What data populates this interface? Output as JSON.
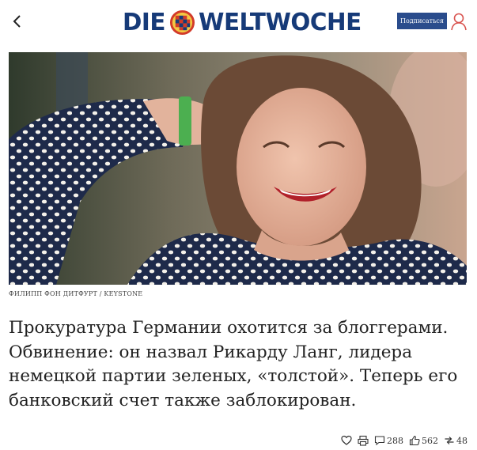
{
  "header": {
    "logo_left": "DIE",
    "logo_right": "WELTWOCHE",
    "subscribe_label": "Подписаться"
  },
  "photo": {
    "caption": "ФИЛИПП ФОН ДИТФУРТ / KEYSTONE"
  },
  "article": {
    "headline": "Прокуратура Германии охотится за блоггерами. Обвинение: он назвал Рикарду Ланг, лидера немецкой партии зеленых, «толстой». Теперь его банковский счет также заблокирован."
  },
  "actions": {
    "comments": "288",
    "likes": "562",
    "reposts": "48"
  },
  "colors": {
    "brand": "#163a78",
    "subscribe_bg": "#2a4c8c",
    "user_icon": "#d9534f"
  }
}
